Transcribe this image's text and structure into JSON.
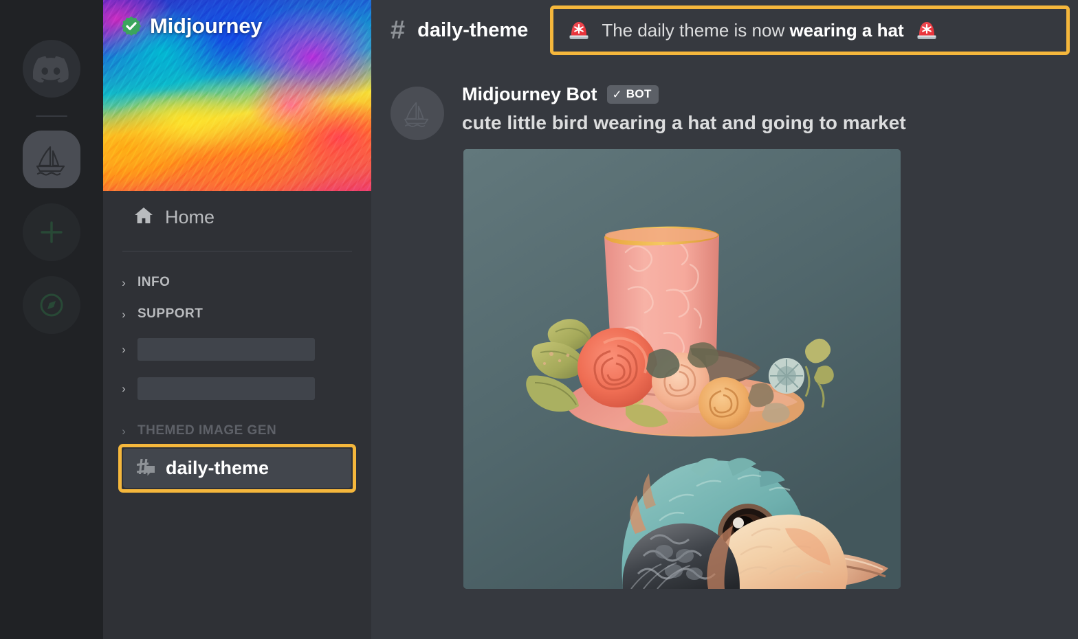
{
  "server_rail": {
    "items": [
      {
        "name": "discord-home",
        "icon": "discord-logo-icon",
        "state": "inactive"
      },
      {
        "name": "midjourney-server",
        "icon": "sailboat-icon",
        "state": "active"
      },
      {
        "name": "add-server",
        "icon": "plus-icon",
        "state": "faded"
      },
      {
        "name": "explore-servers",
        "icon": "compass-icon",
        "state": "faded"
      }
    ]
  },
  "sidebar": {
    "server_name": "Midjourney",
    "verified_icon": "verified-check-icon",
    "home": {
      "label": "Home",
      "icon": "home-icon"
    },
    "categories": [
      {
        "label": "INFO",
        "redacted": false,
        "dim": false
      },
      {
        "label": "SUPPORT",
        "redacted": false,
        "dim": false
      },
      {
        "label": "",
        "redacted": true,
        "dim": false
      },
      {
        "label": "",
        "redacted": true,
        "dim": false
      },
      {
        "label": "THEMED IMAGE GEN",
        "redacted": false,
        "dim": true
      }
    ],
    "active_channel": {
      "label": "daily-theme",
      "icon": "hash-chat-icon"
    }
  },
  "topbar": {
    "hash_icon": "hash-icon",
    "channel_name": "daily-theme",
    "topic_prefix": "The daily theme is now ",
    "topic_highlight": "wearing a hat",
    "siren_icon": "siren-light-icon"
  },
  "message": {
    "avatar_icon": "midjourney-sailboat-avatar",
    "author": "Midjourney Bot",
    "bot_badge": {
      "check": "✓",
      "label": "BOT"
    },
    "text": "cute little bird wearing a hat and going to market",
    "attachment": {
      "name": "bird-in-floral-top-hat-image",
      "alt": "illustrated teal and cream bird wearing a pink floral top hat"
    }
  },
  "colors": {
    "accent_highlight": "#f5b73c",
    "server_rail_bg": "#202225",
    "sidebar_bg": "#2f3136",
    "main_bg": "#36393f",
    "channel_active_bg": "#42464d",
    "text_primary": "#ffffff",
    "text_muted": "#b9bbbe",
    "verified_green": "#3ba55d",
    "siren_red": "#e8343c"
  }
}
